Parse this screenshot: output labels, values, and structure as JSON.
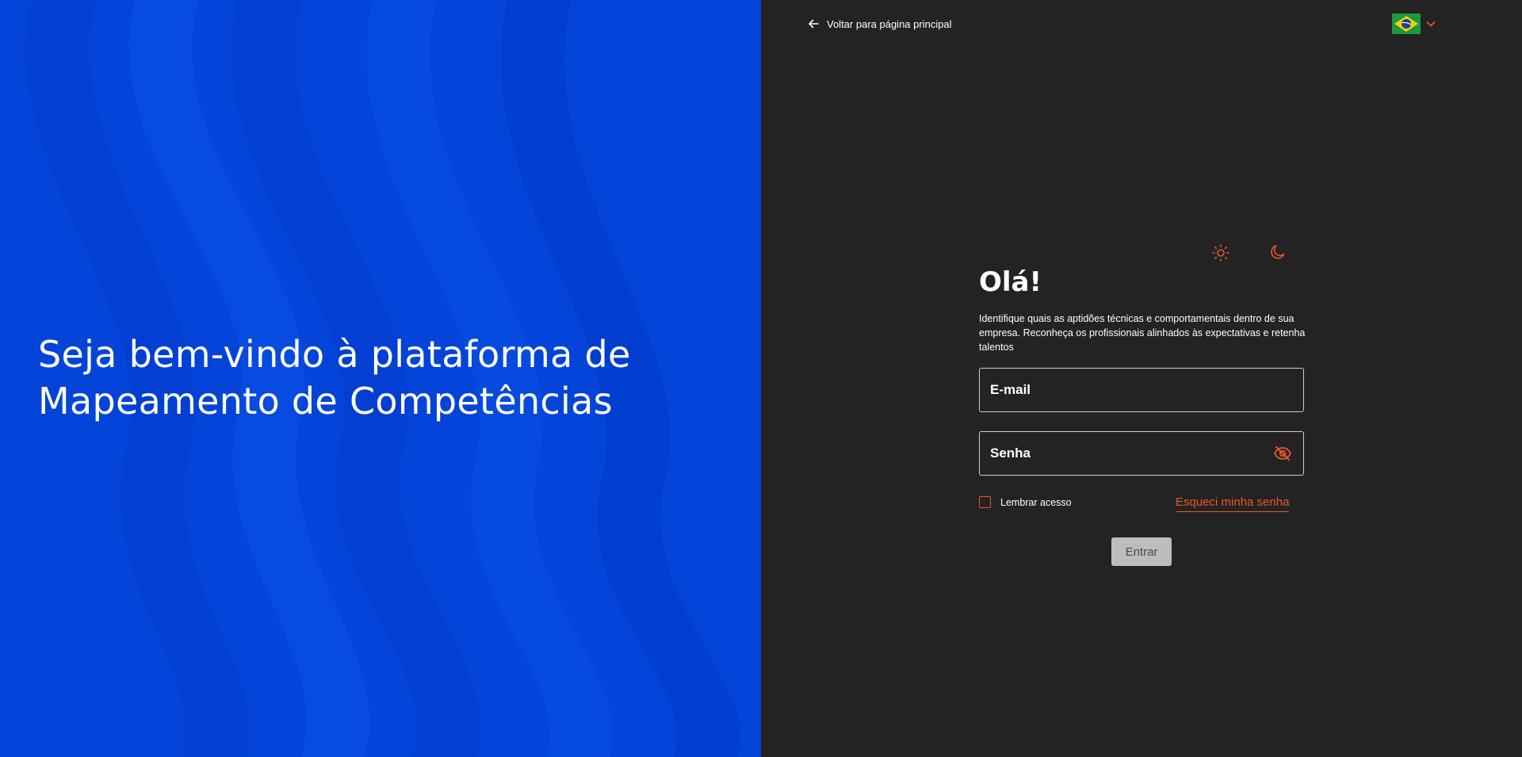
{
  "hero": {
    "title_line1": "Seja bem-vindo à plataforma de",
    "title_line2": "Mapeamento de Competências"
  },
  "header": {
    "back_label": "Voltar para página principal",
    "back_icon": "arrow-left-icon",
    "language_flag": "brazil-flag-icon",
    "language_chevron": "chevron-down-icon"
  },
  "theme": {
    "light_icon": "sun-icon",
    "dark_icon": "moon-icon"
  },
  "login": {
    "greeting": "Olá!",
    "intro": "Identifique quais as aptidões técnicas e comportamentais dentro de sua empresa. Reconheça os profissionais alinhados às expectativas e retenha talentos",
    "email_placeholder": "E-mail",
    "password_placeholder": "Senha",
    "password_toggle_icon": "eye-off-icon",
    "remember_label": "Lembrar acesso",
    "forgot_label": "Esqueci minha senha",
    "submit_label": "Entrar"
  },
  "colors": {
    "hero_blue": "#0444d8",
    "panel_bg": "#232323",
    "accent_orange": "#e8572a",
    "button_disabled": "#bdbdbd"
  }
}
